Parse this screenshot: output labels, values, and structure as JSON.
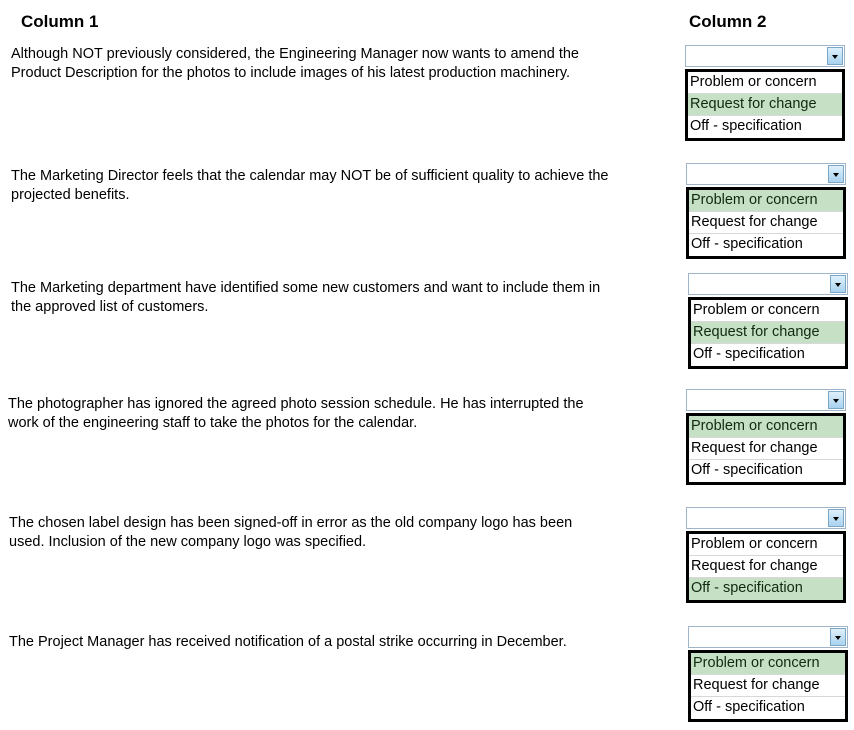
{
  "headers": {
    "column1": "Column 1",
    "column2": "Column 2"
  },
  "options": [
    "Problem or concern",
    "Request for change",
    "Off - specification"
  ],
  "highlight_color": "#c6e0c5",
  "rows": [
    {
      "statement": "Although NOT previously considered, the Engineering Manager now wants to amend the Product Description for the photos to include images of his latest production machinery.",
      "selected": "Request for change"
    },
    {
      "statement": "The Marketing Director feels that the calendar may NOT be of sufficient quality to achieve the projected benefits.",
      "selected": "Problem or concern"
    },
    {
      "statement": "The Marketing department have identified some new customers and want to include them in the approved list of customers.",
      "selected": "Request for change"
    },
    {
      "statement": "The photographer has ignored the agreed photo session schedule. He has interrupted the work of the engineering staff to take the photos for the calendar.",
      "selected": "Problem or concern"
    },
    {
      "statement": "The chosen label design has been signed-off in error as the old company logo has been used. Inclusion of the new company logo was specified.",
      "selected": "Off - specification"
    },
    {
      "statement": "The Project Manager has received notification of a postal strike occurring in December.",
      "selected": "Problem or concern"
    }
  ]
}
